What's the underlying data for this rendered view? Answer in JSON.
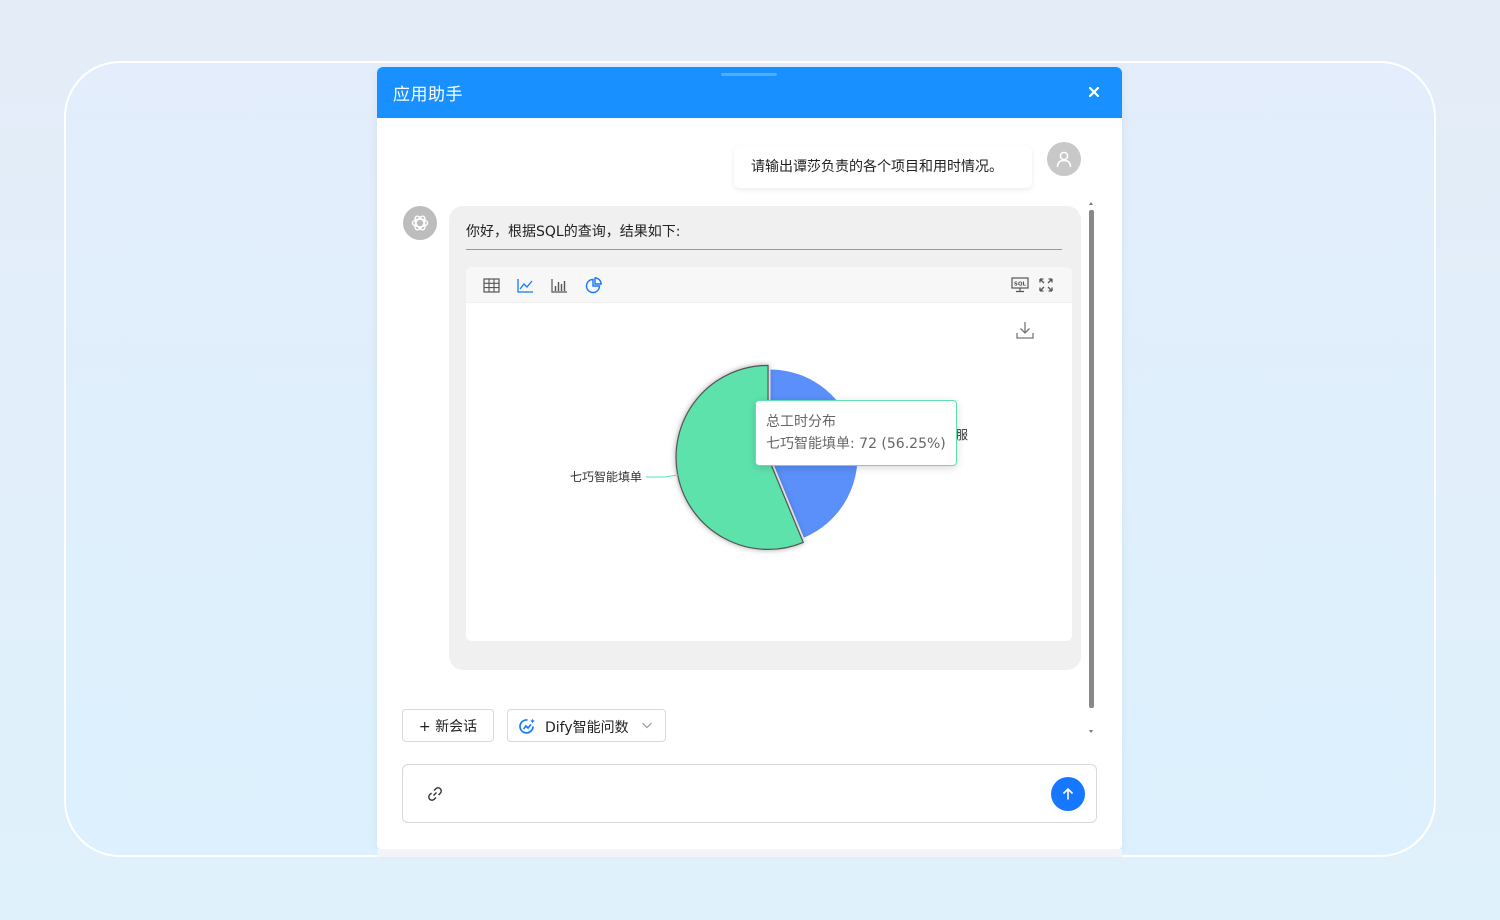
{
  "dialog": {
    "title": "应用助手"
  },
  "chat": {
    "user_message": "请输出谭莎负责的各个项目和用时情况。",
    "bot_message": "你好，根据SQL的查询，结果如下:"
  },
  "toolbar": {
    "icons": [
      "table-icon",
      "line-chart-icon",
      "bar-chart-icon",
      "pie-chart-icon",
      "sql-icon",
      "fullscreen-icon"
    ]
  },
  "chart_data": {
    "type": "pie",
    "series": [
      {
        "name": "总工时分布",
        "values": [
          56,
          72
        ]
      }
    ],
    "categories": [
      "服",
      "七巧智能填单"
    ],
    "colors": [
      "#5b8ff9",
      "#5ee2ac"
    ],
    "labels": {
      "slice_1": "七巧智能填单",
      "slice_0_partial": "服"
    },
    "tooltip": {
      "title": "总工时分布",
      "text": "七巧智能填单: 72 (56.25%)"
    }
  },
  "actions": {
    "new_chat": "+ 新会话",
    "mode": "Dify智能问数"
  },
  "input": {
    "placeholder": ""
  },
  "colors": {
    "primary": "#1890ff",
    "send": "#1677ff",
    "pie_blue": "#5b8ff9",
    "pie_green": "#5ee2ac"
  }
}
